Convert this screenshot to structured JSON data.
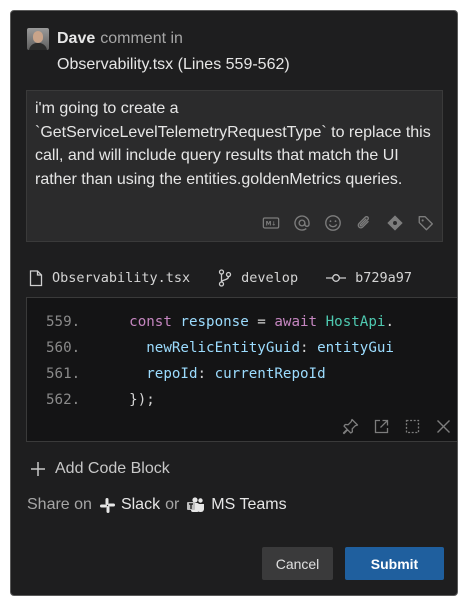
{
  "comment": {
    "author": "Dave",
    "action": "comment in",
    "file_ref": "Observability.tsx (Lines 559-562)",
    "body": "i'm going to create a `GetServiceLevelTelemetryRequestType` to replace this call, and will include query results that match the UI rather than using the entities.goldenMetrics queries."
  },
  "toolbar_icons": [
    "markdown-icon",
    "mention-icon",
    "emoji-icon",
    "attachment-icon",
    "pullrequest-icon",
    "tag-icon"
  ],
  "code_meta": {
    "file": "Observability.tsx",
    "branch": "develop",
    "commit": "b729a97"
  },
  "code_lines": [
    {
      "num": "559.",
      "indent": "    ",
      "tokens": [
        {
          "t": "const ",
          "c": "kw"
        },
        {
          "t": "response ",
          "c": "var"
        },
        {
          "t": "= ",
          "c": "pun"
        },
        {
          "t": "await ",
          "c": "kw"
        },
        {
          "t": "HostApi",
          "c": "cls"
        },
        {
          "t": ".",
          "c": "pun"
        }
      ]
    },
    {
      "num": "560.",
      "indent": "      ",
      "tokens": [
        {
          "t": "newRelicEntityGuid",
          "c": "var"
        },
        {
          "t": ": ",
          "c": "pun"
        },
        {
          "t": "entityGui",
          "c": "var"
        }
      ]
    },
    {
      "num": "561.",
      "indent": "      ",
      "tokens": [
        {
          "t": "repoId",
          "c": "var"
        },
        {
          "t": ": ",
          "c": "pun"
        },
        {
          "t": "currentRepoId",
          "c": "var"
        }
      ]
    },
    {
      "num": "562.",
      "indent": "    ",
      "tokens": [
        {
          "t": "});",
          "c": "pun"
        }
      ]
    }
  ],
  "code_tool_icons": [
    "pin-icon",
    "open-external-icon",
    "select-range-icon",
    "remove-icon"
  ],
  "add_code_block": "Add Code Block",
  "share": {
    "prefix": "Share on",
    "slack": "Slack",
    "or": "or",
    "teams": "MS Teams"
  },
  "buttons": {
    "cancel": "Cancel",
    "submit": "Submit"
  }
}
